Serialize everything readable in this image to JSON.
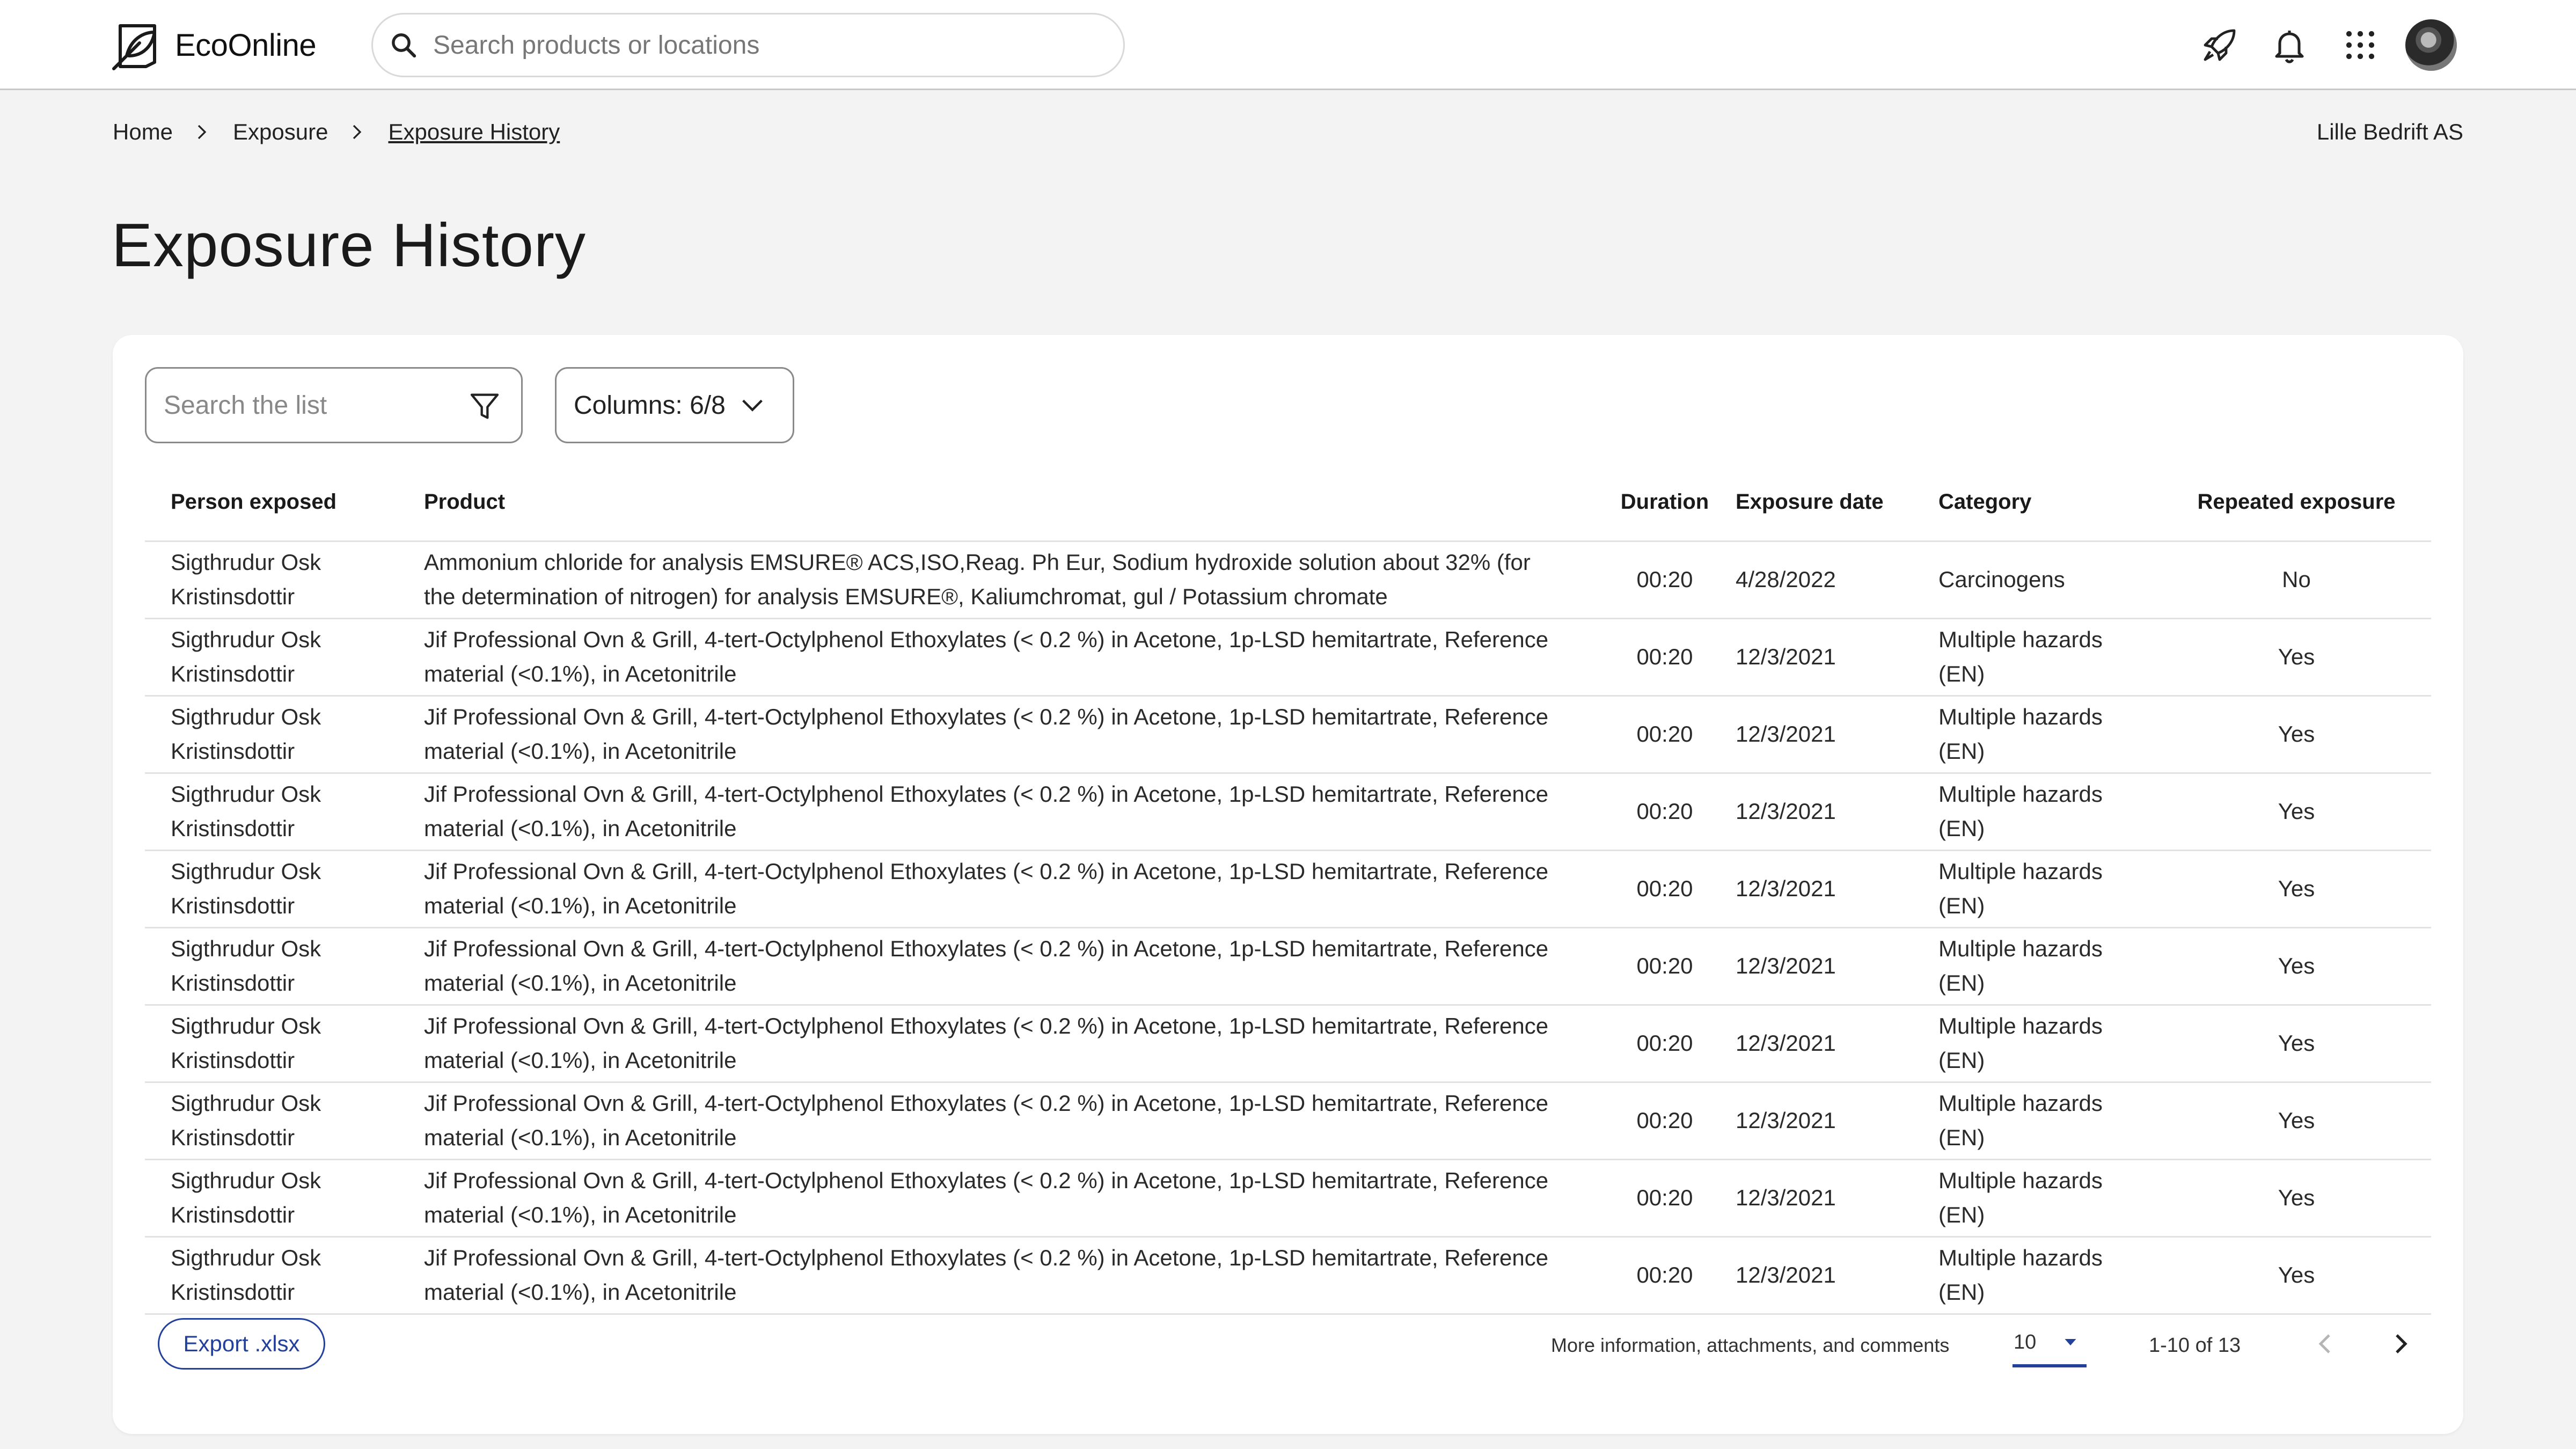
{
  "brand": {
    "name": "EcoOnline"
  },
  "global_search": {
    "placeholder": "Search products or locations"
  },
  "top_icons": [
    "rocket-icon",
    "bell-icon",
    "apps-grid-icon"
  ],
  "breadcrumb": {
    "items": [
      "Home",
      "Exposure",
      "Exposure History"
    ]
  },
  "company": "Lille Bedrift AS",
  "page_title": "Exposure History",
  "list_search": {
    "placeholder": "Search the list"
  },
  "columns_button": {
    "label": "Columns: 6/8"
  },
  "table": {
    "headers": {
      "person": "Person exposed",
      "product": "Product",
      "duration": "Duration",
      "date": "Exposure date",
      "category": "Category",
      "repeated": "Repeated exposure"
    },
    "rows": [
      {
        "person": "Sigthrudur Osk Kristinsdottir",
        "product": "Ammonium chloride for analysis EMSURE® ACS,ISO,Reag. Ph Eur, Sodium hydroxide solution about 32% (for the determination of nitrogen) for analysis EMSURE®, Kaliumchromat, gul / Potassium chromate",
        "duration": "00:20",
        "date": "4/28/2022",
        "category": "Carcinogens",
        "repeated": "No"
      },
      {
        "person": "Sigthrudur Osk Kristinsdottir",
        "product": "Jif Professional Ovn & Grill, 4-tert-Octylphenol Ethoxylates (< 0.2 %) in Acetone, 1p-LSD hemitartrate, Reference material (<0.1%), in Acetonitrile",
        "duration": "00:20",
        "date": "12/3/2021",
        "category": "Multiple hazards (EN)",
        "repeated": "Yes"
      },
      {
        "person": "Sigthrudur Osk Kristinsdottir",
        "product": "Jif Professional Ovn & Grill, 4-tert-Octylphenol Ethoxylates (< 0.2 %) in Acetone, 1p-LSD hemitartrate, Reference material (<0.1%), in Acetonitrile",
        "duration": "00:20",
        "date": "12/3/2021",
        "category": "Multiple hazards (EN)",
        "repeated": "Yes"
      },
      {
        "person": "Sigthrudur Osk Kristinsdottir",
        "product": "Jif Professional Ovn & Grill, 4-tert-Octylphenol Ethoxylates (< 0.2 %) in Acetone, 1p-LSD hemitartrate, Reference material (<0.1%), in Acetonitrile",
        "duration": "00:20",
        "date": "12/3/2021",
        "category": "Multiple hazards (EN)",
        "repeated": "Yes"
      },
      {
        "person": "Sigthrudur Osk Kristinsdottir",
        "product": "Jif Professional Ovn & Grill, 4-tert-Octylphenol Ethoxylates (< 0.2 %) in Acetone, 1p-LSD hemitartrate, Reference material (<0.1%), in Acetonitrile",
        "duration": "00:20",
        "date": "12/3/2021",
        "category": "Multiple hazards (EN)",
        "repeated": "Yes"
      },
      {
        "person": "Sigthrudur Osk Kristinsdottir",
        "product": "Jif Professional Ovn & Grill, 4-tert-Octylphenol Ethoxylates (< 0.2 %) in Acetone, 1p-LSD hemitartrate, Reference material (<0.1%), in Acetonitrile",
        "duration": "00:20",
        "date": "12/3/2021",
        "category": "Multiple hazards (EN)",
        "repeated": "Yes"
      },
      {
        "person": "Sigthrudur Osk Kristinsdottir",
        "product": "Jif Professional Ovn & Grill, 4-tert-Octylphenol Ethoxylates (< 0.2 %) in Acetone, 1p-LSD hemitartrate, Reference material (<0.1%), in Acetonitrile",
        "duration": "00:20",
        "date": "12/3/2021",
        "category": "Multiple hazards (EN)",
        "repeated": "Yes"
      },
      {
        "person": "Sigthrudur Osk Kristinsdottir",
        "product": "Jif Professional Ovn & Grill, 4-tert-Octylphenol Ethoxylates (< 0.2 %) in Acetone, 1p-LSD hemitartrate, Reference material (<0.1%), in Acetonitrile",
        "duration": "00:20",
        "date": "12/3/2021",
        "category": "Multiple hazards (EN)",
        "repeated": "Yes"
      },
      {
        "person": "Sigthrudur Osk Kristinsdottir",
        "product": "Jif Professional Ovn & Grill, 4-tert-Octylphenol Ethoxylates (< 0.2 %) in Acetone, 1p-LSD hemitartrate, Reference material (<0.1%), in Acetonitrile",
        "duration": "00:20",
        "date": "12/3/2021",
        "category": "Multiple hazards (EN)",
        "repeated": "Yes"
      },
      {
        "person": "Sigthrudur Osk Kristinsdottir",
        "product": "Jif Professional Ovn & Grill, 4-tert-Octylphenol Ethoxylates (< 0.2 %) in Acetone, 1p-LSD hemitartrate, Reference material (<0.1%), in Acetonitrile",
        "duration": "00:20",
        "date": "12/3/2021",
        "category": "Multiple hazards (EN)",
        "repeated": "Yes"
      }
    ]
  },
  "footer": {
    "export_label": "Export .xlsx",
    "more_info": "More information, attachments, and comments",
    "per_page": "10",
    "range": "1-10 of 13"
  },
  "colors": {
    "accent": "#23409a",
    "background": "#f3f3f3"
  }
}
